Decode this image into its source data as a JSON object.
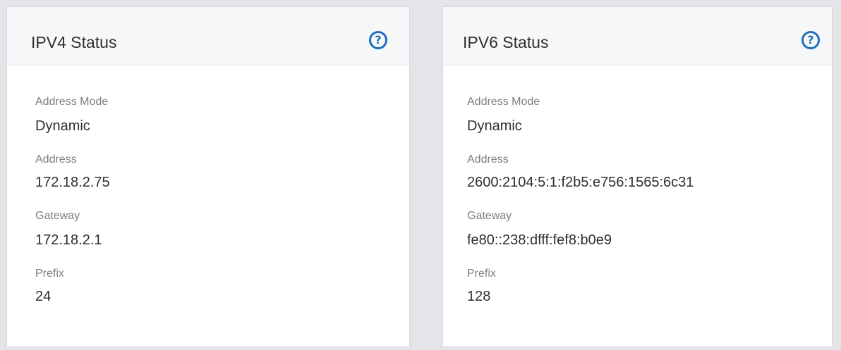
{
  "ipv4": {
    "title": "IPV4 Status",
    "help_glyph": "?",
    "fields": [
      {
        "label": "Address Mode",
        "value": "Dynamic"
      },
      {
        "label": "Address",
        "value": "172.18.2.75"
      },
      {
        "label": "Gateway",
        "value": "172.18.2.1"
      },
      {
        "label": "Prefix",
        "value": "24"
      }
    ]
  },
  "ipv6": {
    "title": "IPV6 Status",
    "help_glyph": "?",
    "fields": [
      {
        "label": "Address Mode",
        "value": "Dynamic"
      },
      {
        "label": "Address",
        "value": "2600:2104:5:1:f2b5:e756:1565:6c31"
      },
      {
        "label": "Gateway",
        "value": "fe80::238:dfff:fef8:b0e9"
      },
      {
        "label": "Prefix",
        "value": "128"
      }
    ]
  },
  "colors": {
    "accent": "#1f6fb9",
    "background": "#e3e5e8",
    "header": "#f6f7f8",
    "label": "#7b7f84",
    "text": "#2e2f31"
  },
  "icons": {
    "help": "help-icon"
  }
}
